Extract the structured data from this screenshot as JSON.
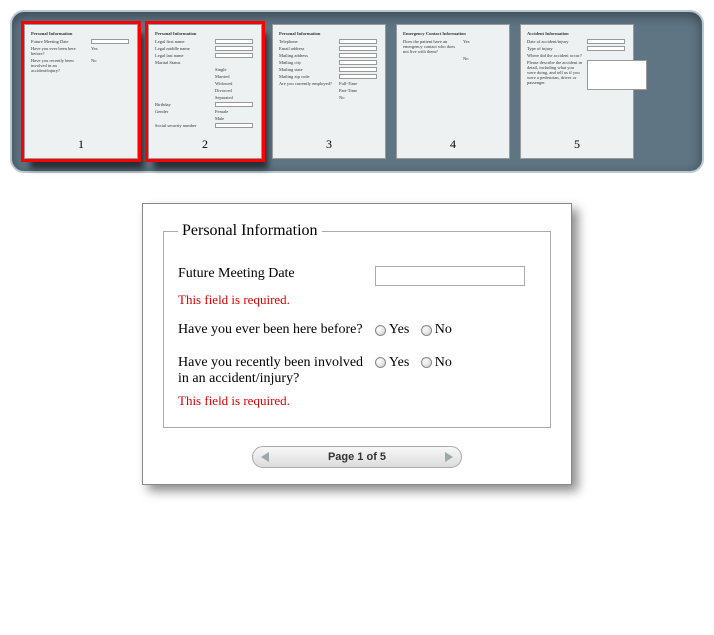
{
  "thumbs": [
    {
      "num": "1",
      "selected": true,
      "header": "Personal Information",
      "lines": [
        {
          "l": "Future Meeting Date",
          "c": "box"
        },
        {
          "l": "Have you ever been here before?",
          "c": "Yes"
        },
        {
          "l": "Have you recently been involved in an accident/injury?",
          "c": "No"
        }
      ]
    },
    {
      "num": "2",
      "selected": true,
      "header": "Personal Information",
      "lines": [
        {
          "l": "Legal first name",
          "c": "box"
        },
        {
          "l": "Legal middle name",
          "c": "box"
        },
        {
          "l": "Legal last name",
          "c": "box"
        },
        {
          "l": "Marital Status",
          "c": ""
        },
        {
          "l": "",
          "c": "Single"
        },
        {
          "l": "",
          "c": "Married"
        },
        {
          "l": "",
          "c": "Widowed"
        },
        {
          "l": "",
          "c": "Divorced"
        },
        {
          "l": "",
          "c": "Separated"
        },
        {
          "l": "Birthday",
          "c": "box"
        },
        {
          "l": "Gender",
          "c": "Female"
        },
        {
          "l": "",
          "c": "Male"
        },
        {
          "l": "Social security number",
          "c": "box"
        }
      ]
    },
    {
      "num": "3",
      "selected": false,
      "header": "Personal Information",
      "lines": [
        {
          "l": "Telephone",
          "c": "box"
        },
        {
          "l": "Email address",
          "c": "box"
        },
        {
          "l": "Mailing address",
          "c": "box"
        },
        {
          "l": "Mailing city",
          "c": "box"
        },
        {
          "l": "Mailing state",
          "c": "box"
        },
        {
          "l": "Mailing zip code",
          "c": "box"
        },
        {
          "l": "Are you currently employed?",
          "c": "Full-Time"
        },
        {
          "l": "",
          "c": "Part-Time"
        },
        {
          "l": "",
          "c": "No"
        }
      ]
    },
    {
      "num": "4",
      "selected": false,
      "header": "Emergency Contact Information",
      "lines": [
        {
          "l": "Does the patient have an emergency contact who does not live with them?",
          "c": "Yes"
        },
        {
          "l": "",
          "c": "No"
        }
      ]
    },
    {
      "num": "5",
      "selected": false,
      "header": "Accident Information",
      "lines": [
        {
          "l": "Date of accident/injury",
          "c": "box"
        },
        {
          "l": "Type of injury",
          "c": "box"
        },
        {
          "l": "Where did the accident occur?",
          "c": ""
        },
        {
          "l": "Please describe the accident in detail, including what you were doing, and tell us if you were a pedestrian, driver or passenger.",
          "c": "tarea"
        }
      ]
    }
  ],
  "form": {
    "legend": "Personal Information",
    "q1": {
      "label": "Future Meeting Date",
      "err": "This field is required."
    },
    "q2": {
      "label": "Have you ever been here before?",
      "opt1": "Yes",
      "opt2": "No"
    },
    "q3": {
      "label": "Have you recently been involved in an accident/injury?",
      "opt1": "Yes",
      "opt2": "No",
      "err": "This field is required."
    }
  },
  "pager": {
    "text": "Page 1 of 5"
  }
}
